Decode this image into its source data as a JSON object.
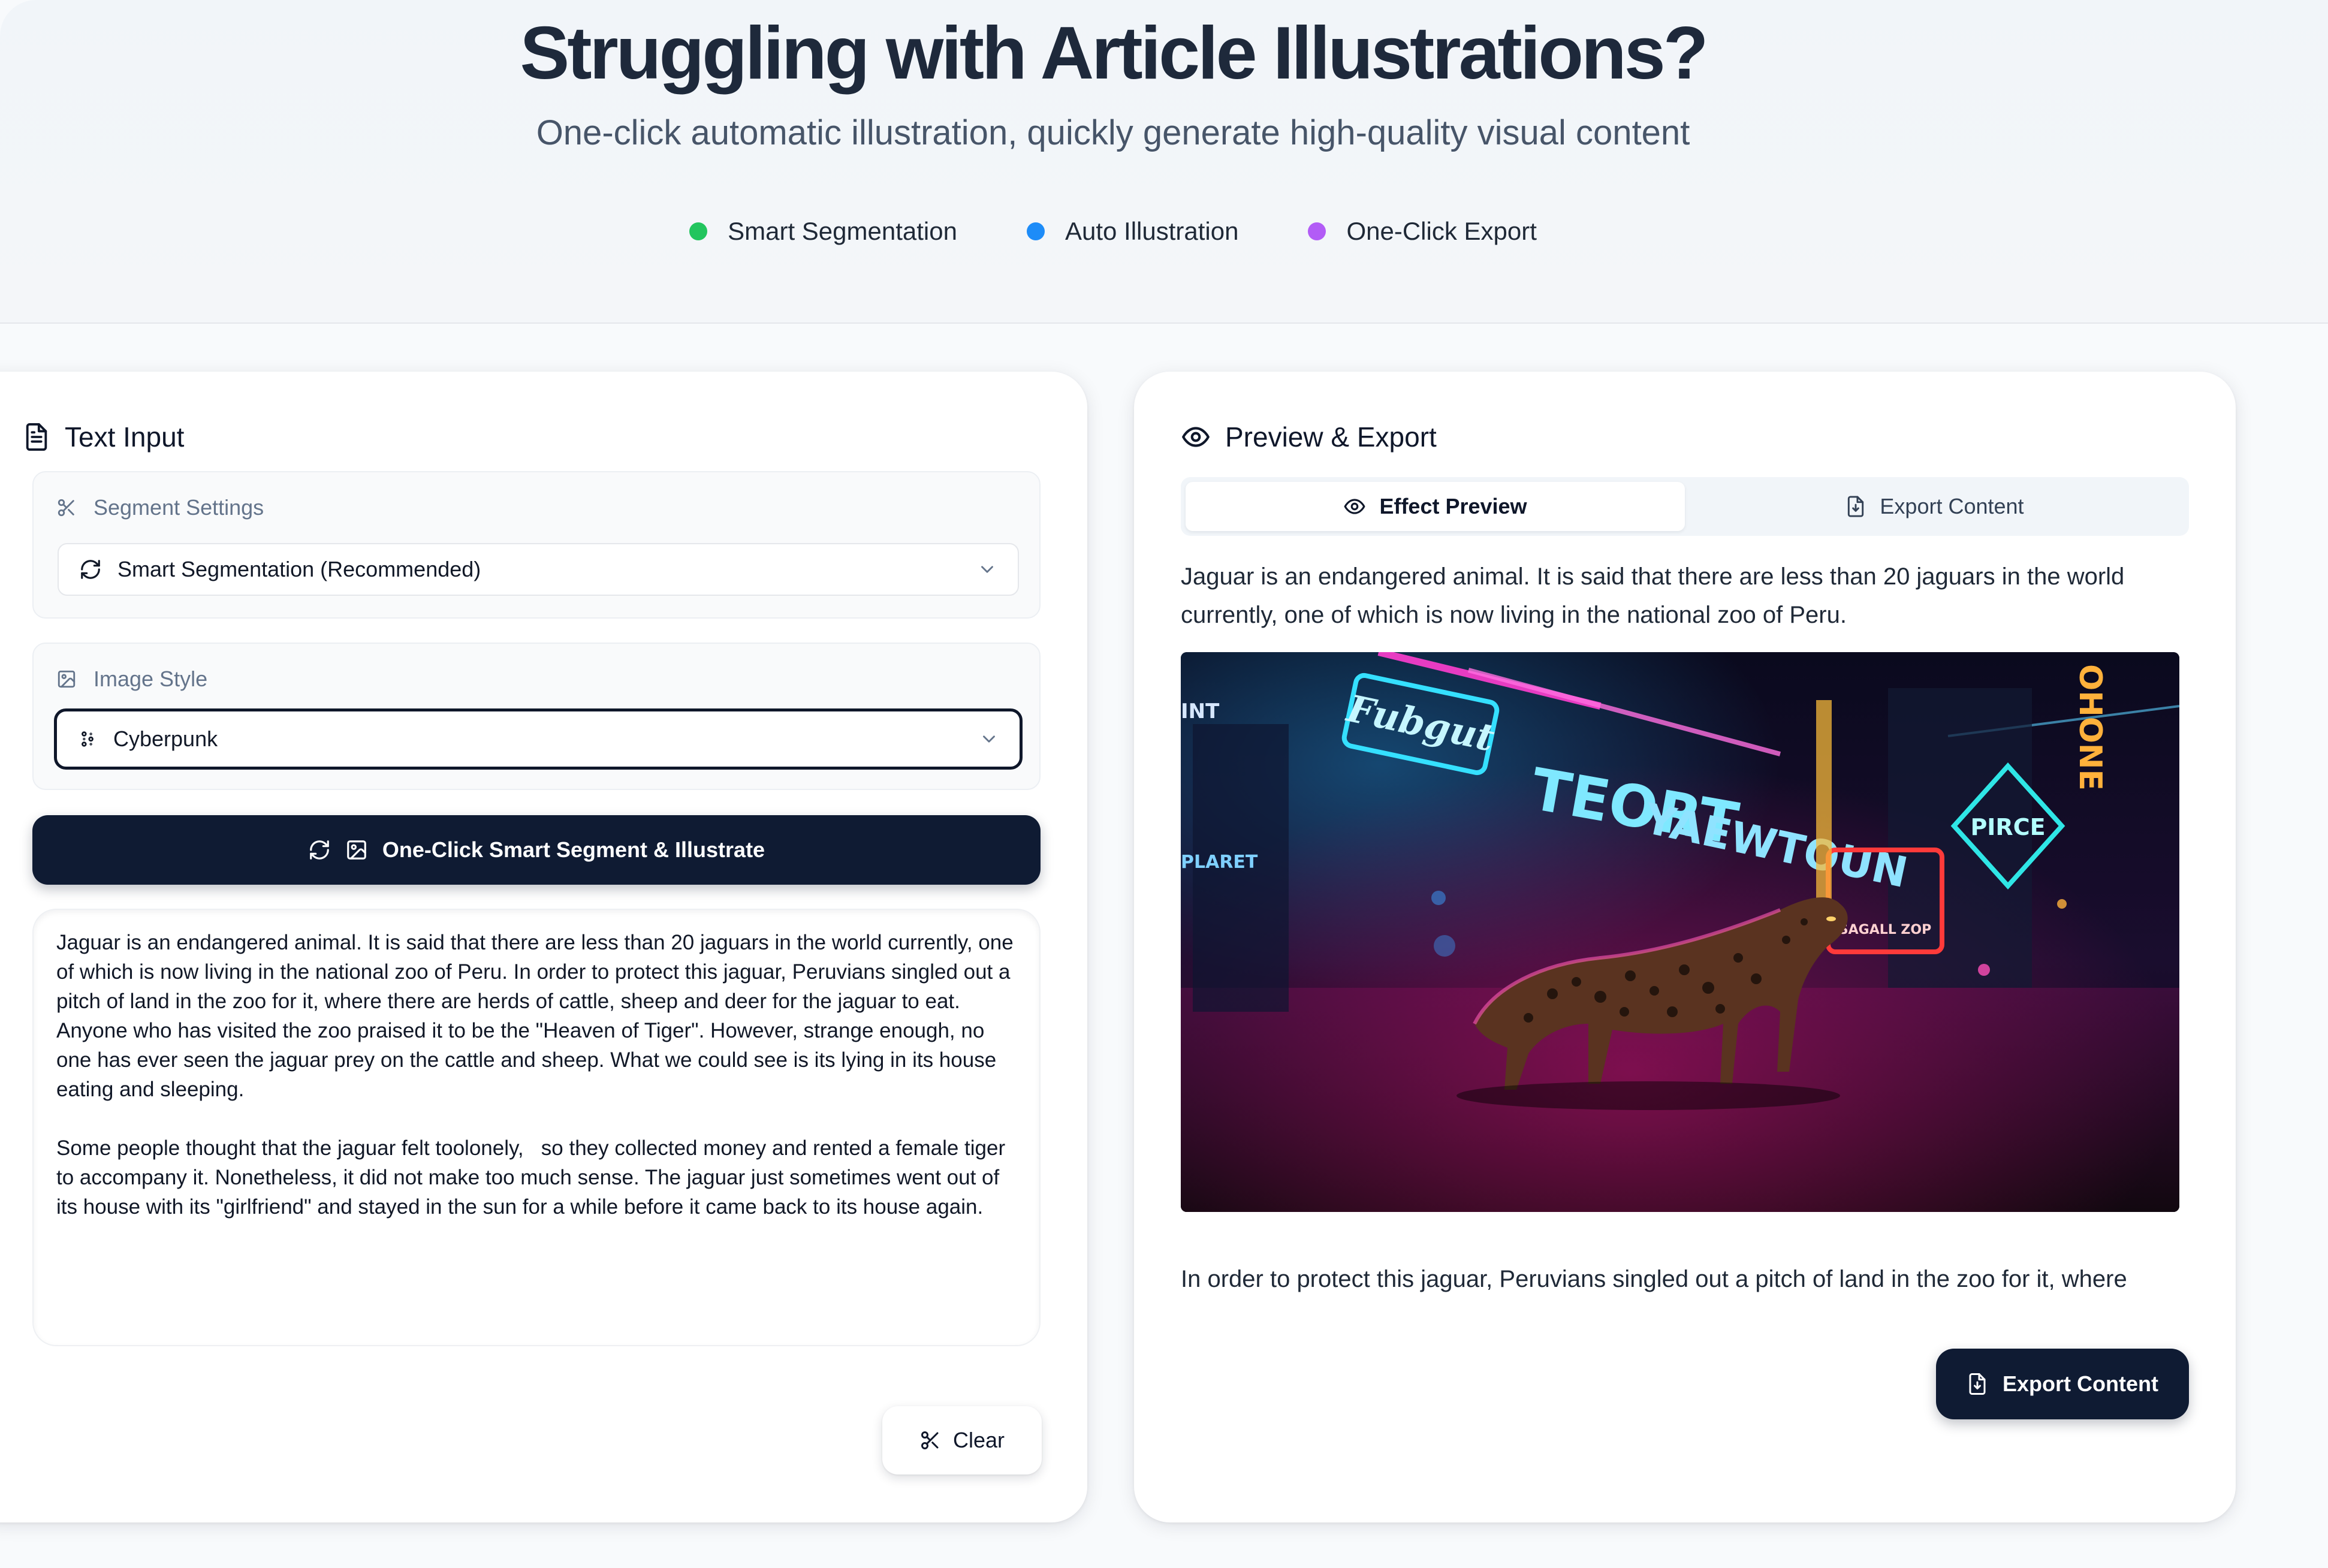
{
  "hero": {
    "title": "Struggling with Article Illustrations?",
    "subtitle": "One-click automatic illustration, quickly generate high-quality visual content",
    "features": [
      {
        "label": "Smart Segmentation",
        "color": "#22c55e"
      },
      {
        "label": "Auto Illustration",
        "color": "#1d8cf8"
      },
      {
        "label": "One-Click Export",
        "color": "#b25cf6"
      }
    ]
  },
  "input_panel": {
    "title": "Text Input",
    "segment": {
      "label": "Segment Settings",
      "value": "Smart Segmentation (Recommended)"
    },
    "style": {
      "label": "Image Style",
      "value": "Cyberpunk"
    },
    "generate_label": "One-Click Smart Segment & Illustrate",
    "text": "Jaguar is an endangered animal. It is said that there are less than 20 jaguars in the world currently, one of which is now living in the national zoo of Peru. In order to protect this jaguar, Peruvians singled out a pitch of land in the zoo for it, where there are herds of cattle, sheep and deer for the jaguar to eat. Anyone who has visited the zoo praised it to be the \"Heaven of Tiger\". However, strange enough, no one has ever seen the jaguar prey on the cattle and sheep. What we could see is its lying in its house eating and sleeping.\n\nSome people thought that the jaguar felt toolonely,   so they collected money and rented a female tiger to accompany it. Nonetheless, it did not make too much sense. The jaguar just sometimes went out of its house with its \"girlfriend\" and stayed in the sun for a while before it came back to its house again.",
    "clear_label": "Clear"
  },
  "preview_panel": {
    "title": "Preview & Export",
    "tabs": [
      {
        "label": "Effect Preview",
        "active": true
      },
      {
        "label": "Export Content",
        "active": false
      }
    ],
    "paragraph_1": "Jaguar is an endangered animal. It is said that there are less than 20 jaguars in the world currently, one of which is now living in the national zoo of Peru.",
    "image_signs": {
      "fubgut": "Fubgut",
      "teort": "TEORT",
      "yaewtoun": "YAEWTOUN",
      "pirce": "PIRCE",
      "int": "INT",
      "plaret": "PLARET",
      "sagall": "SAGALL ZOP",
      "ohone": "OHONE"
    },
    "paragraph_2": "In order to protect this jaguar, Peruvians singled out a pitch of land in the zoo for it, where",
    "export_label": "Export Content"
  }
}
